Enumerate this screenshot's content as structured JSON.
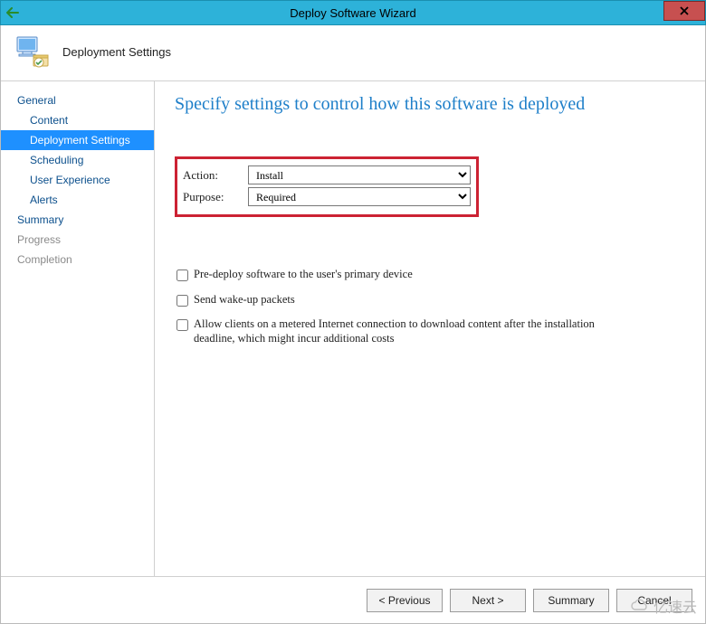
{
  "window": {
    "title": "Deploy Software Wizard"
  },
  "header": {
    "title": "Deployment Settings"
  },
  "sidebar": {
    "items": [
      {
        "label": "General",
        "sub": false,
        "active": false,
        "disabled": false
      },
      {
        "label": "Content",
        "sub": true,
        "active": false,
        "disabled": false
      },
      {
        "label": "Deployment Settings",
        "sub": true,
        "active": true,
        "disabled": false
      },
      {
        "label": "Scheduling",
        "sub": true,
        "active": false,
        "disabled": false
      },
      {
        "label": "User Experience",
        "sub": true,
        "active": false,
        "disabled": false
      },
      {
        "label": "Alerts",
        "sub": true,
        "active": false,
        "disabled": false
      },
      {
        "label": "Summary",
        "sub": false,
        "active": false,
        "disabled": false
      },
      {
        "label": "Progress",
        "sub": false,
        "active": false,
        "disabled": true
      },
      {
        "label": "Completion",
        "sub": false,
        "active": false,
        "disabled": true
      }
    ]
  },
  "main": {
    "heading": "Specify settings to control how this software is deployed",
    "fields": {
      "action_label": "Action:",
      "action_value": "Install",
      "purpose_label": "Purpose:",
      "purpose_value": "Required"
    },
    "checkboxes": [
      {
        "label": "Pre-deploy software to the user's primary device",
        "checked": false
      },
      {
        "label": "Send wake-up packets",
        "checked": false
      },
      {
        "label": "Allow clients on a metered Internet connection to download content after the installation deadline, which might incur additional costs",
        "checked": false
      }
    ]
  },
  "buttons": {
    "previous": "< Previous",
    "next": "Next >",
    "summary": "Summary",
    "cancel": "Cancel"
  },
  "watermark": "亿速云"
}
